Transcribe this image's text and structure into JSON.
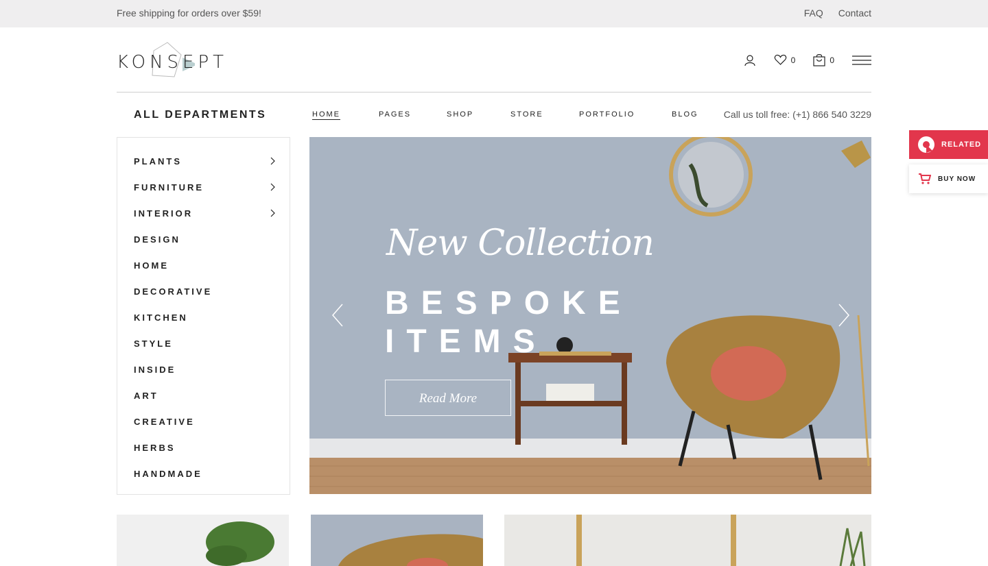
{
  "topbar": {
    "promo": "Free shipping for orders over $59!",
    "faq": "FAQ",
    "contact": "Contact"
  },
  "header": {
    "logo": "KONSEPT",
    "wishlist_count": "0",
    "cart_count": "0",
    "icons": [
      "user-icon",
      "heart-icon",
      "shopping-bag-icon",
      "hamburger-menu-icon"
    ]
  },
  "nav": {
    "all_departments": "ALL DEPARTMENTS",
    "items": [
      "HOME",
      "PAGES",
      "SHOP",
      "STORE",
      "PORTFOLIO",
      "BLOG"
    ],
    "active": "HOME",
    "toll_free": "Call us toll free: (+1) 866 540 3229"
  },
  "sidebar": {
    "items": [
      {
        "label": "PLANTS",
        "has_submenu": true
      },
      {
        "label": "FURNITURE",
        "has_submenu": true
      },
      {
        "label": "INTERIOR",
        "has_submenu": true
      },
      {
        "label": "DESIGN",
        "has_submenu": false
      },
      {
        "label": "HOME",
        "has_submenu": false
      },
      {
        "label": "DECORATIVE",
        "has_submenu": false
      },
      {
        "label": "KITCHEN",
        "has_submenu": false
      },
      {
        "label": "STYLE",
        "has_submenu": false
      },
      {
        "label": "INSIDE",
        "has_submenu": false
      },
      {
        "label": "ART",
        "has_submenu": false
      },
      {
        "label": "CREATIVE",
        "has_submenu": false
      },
      {
        "label": "HERBS",
        "has_submenu": false
      },
      {
        "label": "HANDMADE",
        "has_submenu": false
      }
    ]
  },
  "hero": {
    "script_title": "New Collection",
    "line1": "BESPOKE",
    "line2": "ITEMS",
    "cta": "Read More"
  },
  "floating": {
    "related": "RELATED",
    "buy_now": "BUY NOW"
  },
  "colors": {
    "accent": "#e2364c",
    "topbar_bg": "#efeeef",
    "hero_wall": "#aab5c3"
  }
}
